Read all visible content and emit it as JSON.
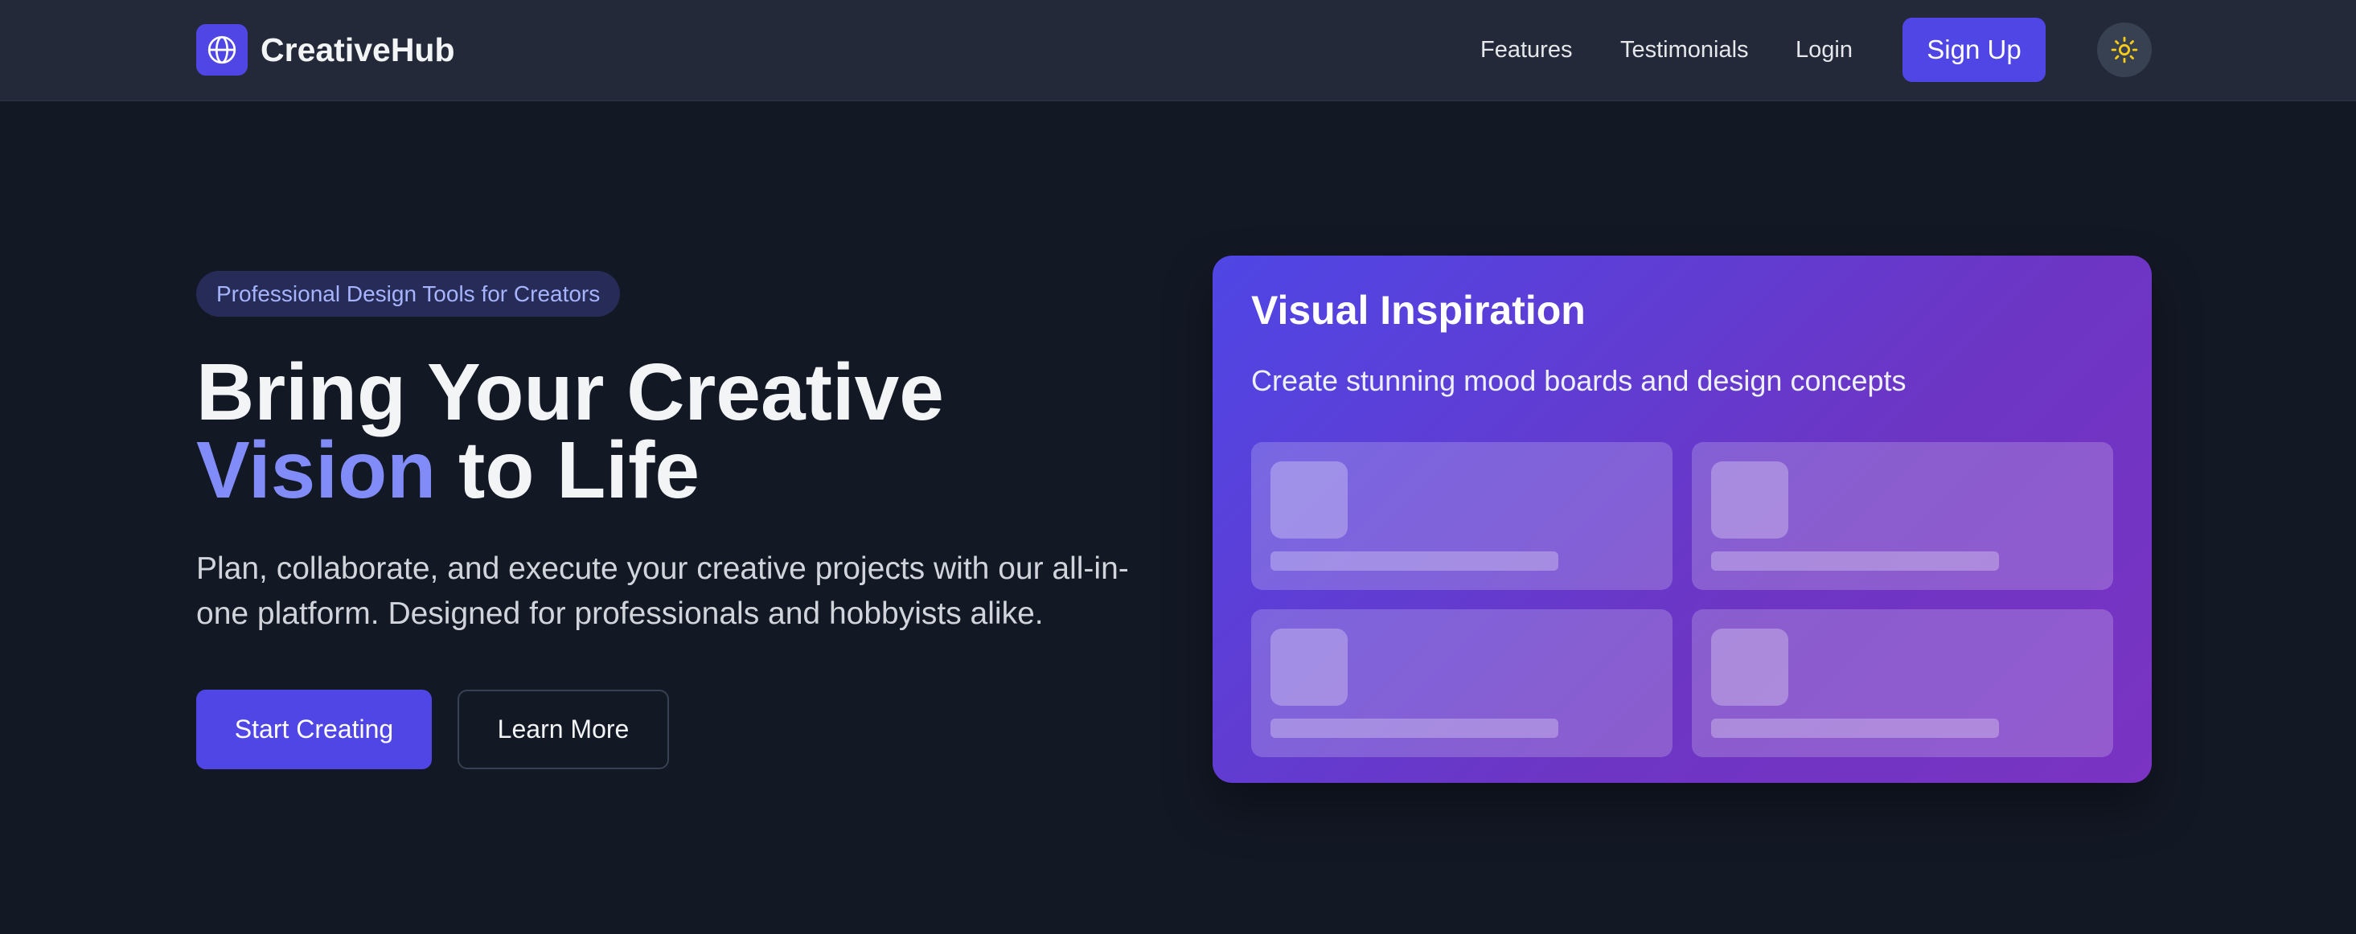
{
  "nav": {
    "brand": "CreativeHub",
    "logo_icon": "globe-icon",
    "links": [
      "Features",
      "Testimonials",
      "Login"
    ],
    "signup_label": "Sign Up",
    "theme_icon": "sun-icon"
  },
  "hero": {
    "badge": "Professional Design Tools for Creators",
    "headline_line1": "Bring Your Creative",
    "headline_accent": "Vision",
    "headline_rest": " to Life",
    "subtext": "Plan, collaborate, and execute your creative projects with our all-in-one platform. Designed for professionals and hobbyists alike.",
    "primary_button": "Start Creating",
    "secondary_button": "Learn More"
  },
  "preview_card": {
    "title": "Visual Inspiration",
    "subtitle": "Create stunning mood boards and design concepts"
  },
  "colors": {
    "accent": "#4f46e5",
    "accent_text": "#818cf8",
    "background": "#131825",
    "nav_background": "#232938",
    "sun": "#facc15"
  }
}
